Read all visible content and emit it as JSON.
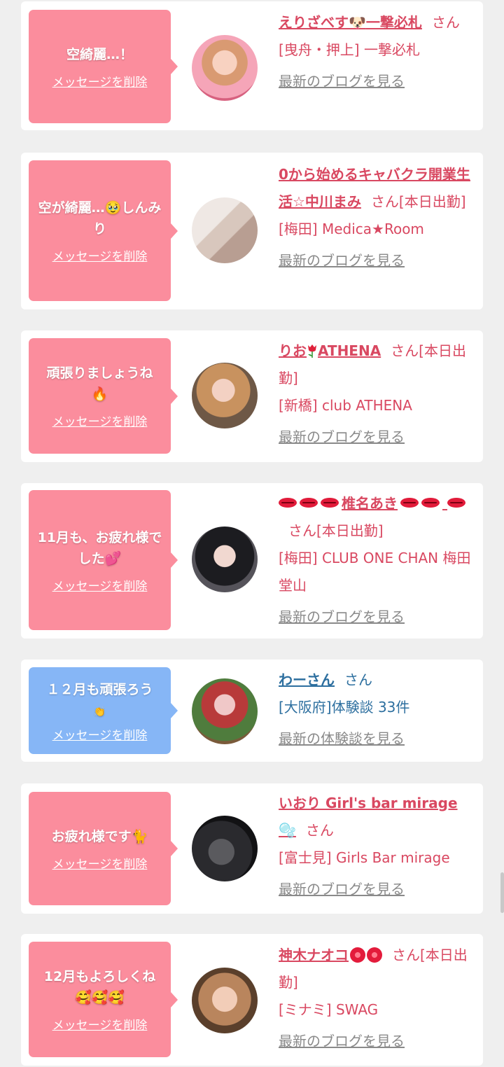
{
  "items": [
    {
      "message": "空綺麗…！",
      "delete_label": "メッセージを削除",
      "name": "えりざべす🐶一撃必札",
      "suffix": "さん",
      "shop": "[曳舟・押上] 一撃必札",
      "more": "最新のブログを見る",
      "type": "pink"
    },
    {
      "message": "空が綺麗…🥹しんみり",
      "delete_label": "メッセージを削除",
      "name": "0から始めるキャバクラ開業生活☆中川まみ",
      "suffix": "さん[本日出勤]",
      "shop": "[梅田] Medica★Room",
      "more": "最新のブログを見る",
      "type": "pink"
    },
    {
      "message": "頑張りましょうね🔥",
      "delete_label": "メッセージを削除",
      "name": "りお🌷ATHENA",
      "suffix": "さん[本日出勤]",
      "shop": "[新橋] club ATHENA",
      "more": "最新のブログを見る",
      "type": "pink"
    },
    {
      "message": "11月も、お疲れ様でした💕",
      "delete_label": "メッセージを削除",
      "name": "💋💋💋椎名あき💋💋💋",
      "suffix": "さん[本日出勤]",
      "shop": "[梅田] CLUB ONE CHAN 梅田堂山",
      "more": "最新のブログを見る",
      "type": "pink"
    },
    {
      "message": "１２月も頑張ろう👏",
      "delete_label": "メッセージを削除",
      "name": "わーさん",
      "suffix": "さん",
      "shop": "[大阪府]体験談 33件",
      "more": "最新の体験談を見る",
      "type": "blue"
    },
    {
      "message": "お疲れ様です🐈",
      "delete_label": "メッセージを削除",
      "name": "いおり Girl's bar mirage🫧",
      "suffix": "さん",
      "shop": "[富士見] Girls Bar mirage",
      "more": "最新のブログを見る",
      "type": "pink"
    },
    {
      "message": "12月もよろしくね🥰🥰🥰",
      "delete_label": "メッセージを削除",
      "name": "神木ナオコ🌹🌹",
      "suffix": "さん[本日出勤]",
      "shop": "[ミナミ] SWAG",
      "more": "最新のブログを見る",
      "type": "pink"
    }
  ],
  "card_0": {
    "message": "空綺麗…！",
    "delete_label": "メッセージを削除",
    "name": "えりざべす",
    "name_tail": "一撃必札",
    "suffix": "さん",
    "shop": "[曳舟・押上] 一撃必札",
    "more": "最新のブログを見る"
  },
  "card_1": {
    "message_a": "空が綺麗…",
    "message_b": "しんみり",
    "delete_label": "メッセージを削除",
    "name": "0から始めるキャバクラ開業生活☆中川まみ",
    "suffix": "さん[本日出勤]",
    "shop": "[梅田] Medica★Room",
    "more": "最新のブログを見る"
  },
  "card_2": {
    "message": "頑張りましょうね",
    "delete_label": "メッセージを削除",
    "name_a": "りお",
    "name_b": "ATHENA",
    "suffix": "さん[本日出勤]",
    "shop": "[新橋] club ATHENA",
    "more": "最新のブログを見る"
  },
  "card_3": {
    "message": "11月も、お疲れ様でした",
    "delete_label": "メッセージを削除",
    "name": "椎名あき",
    "suffix": "さん[本日出勤]",
    "shop": "[梅田] CLUB ONE CHAN 梅田堂山",
    "more": "最新のブログを見る"
  },
  "card_4": {
    "message": "１２月も頑張ろう",
    "delete_label": "メッセージを削除",
    "name": "わーさん",
    "suffix": "さん",
    "shop": "[大阪府]体験談 33件",
    "more": "最新の体験談を見る"
  },
  "card_5": {
    "message": "お疲れ様です",
    "delete_label": "メッセージを削除",
    "name": "いおり Girl's bar mirage",
    "suffix": "さん",
    "shop": "[富士見] Girls Bar mirage",
    "more": "最新のブログを見る"
  },
  "card_6": {
    "message": "12月もよろしくね",
    "delete_label": "メッセージを削除",
    "name": "神木ナオコ",
    "suffix": "さん[本日出勤]",
    "shop": "[ミナミ] SWAG",
    "more": "最新のブログを見る"
  },
  "colors": {
    "pink_bubble": "#fb8d9d",
    "blue_bubble": "#86b6f6",
    "pink_text": "#d94861",
    "blue_text": "#2d6f9f",
    "gray_link": "#8a8a8a"
  }
}
